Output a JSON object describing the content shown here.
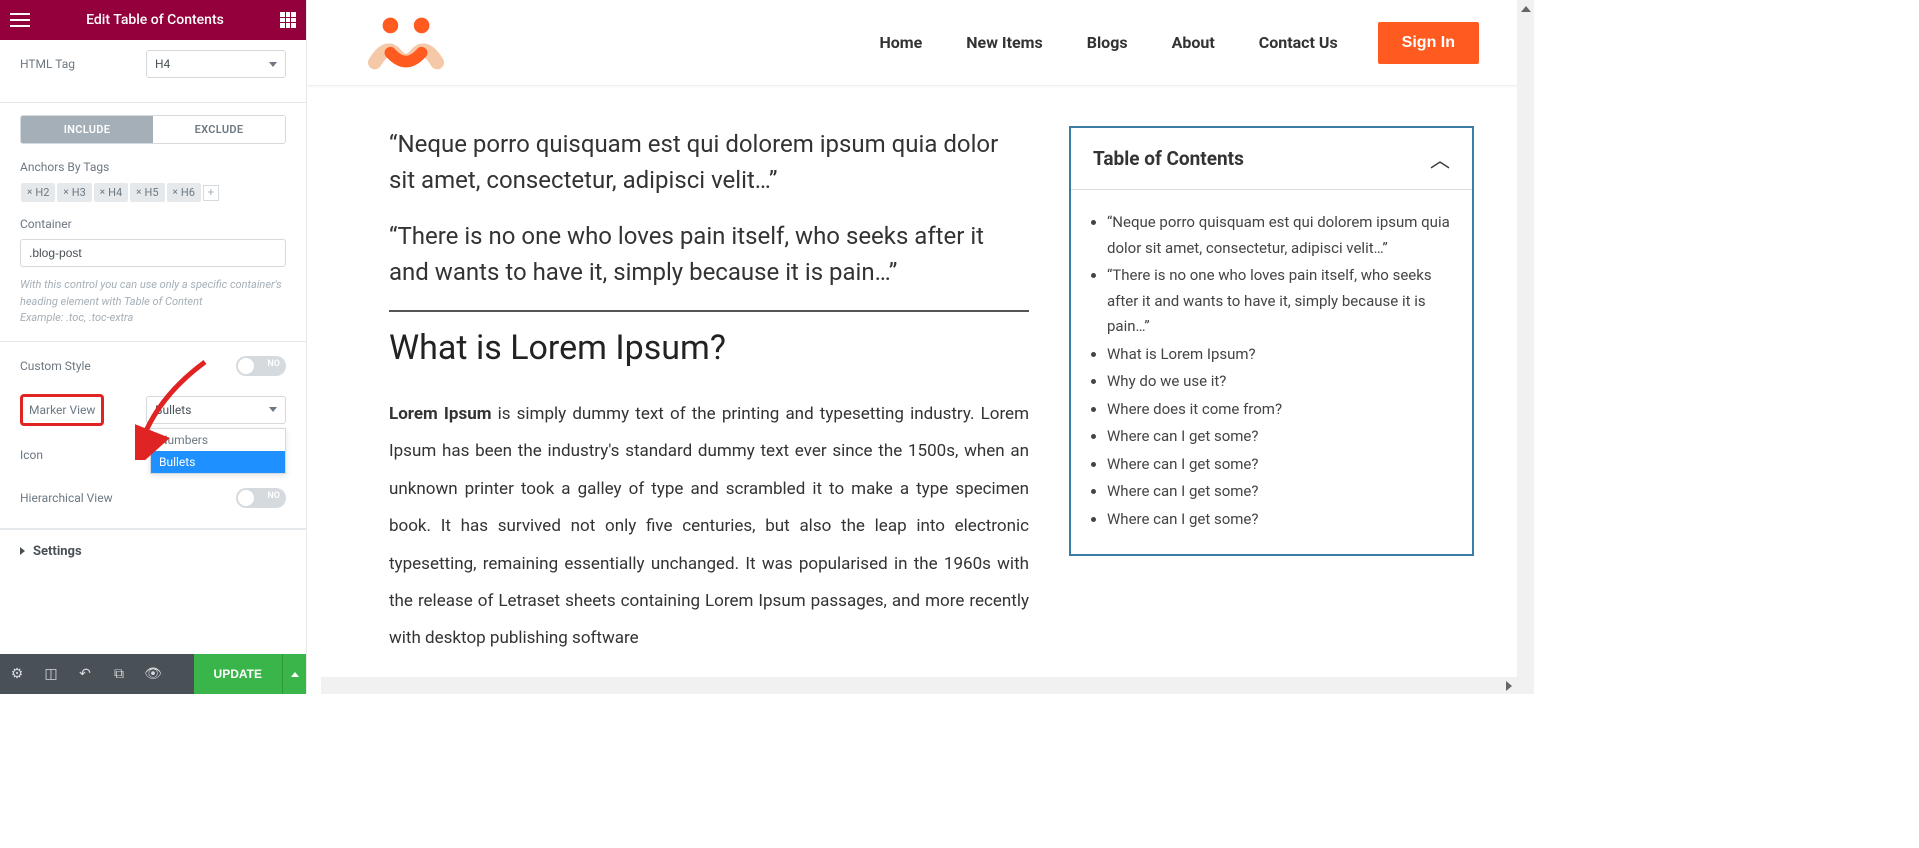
{
  "sidebar": {
    "title": "Edit Table of Contents",
    "html_tag_label": "HTML Tag",
    "html_tag_value": "H4",
    "include": "INCLUDE",
    "exclude": "EXCLUDE",
    "anchors_label": "Anchors By Tags",
    "tags": [
      "H2",
      "H3",
      "H4",
      "H5",
      "H6"
    ],
    "container_label": "Container",
    "container_value": ".blog-post",
    "helper1": "With this control you can use only a specific container's heading element with Table of Content",
    "helper2": "Example: .toc, .toc-extra",
    "custom_style_label": "Custom Style",
    "switch_no": "NO",
    "marker_view_label": "Marker View",
    "marker_view_value": "Bullets",
    "marker_options": {
      "opt1": "Numbers",
      "opt2": "Bullets"
    },
    "icon_label": "Icon",
    "hview_label": "Hierarchical View",
    "settings_label": "Settings",
    "update_label": "UPDATE"
  },
  "nav": {
    "home": "Home",
    "new_items": "New Items",
    "blogs": "Blogs",
    "about": "About",
    "contact": "Contact Us",
    "sign_in": "Sign In"
  },
  "article": {
    "q1": "“Neque porro quisquam est qui dolorem ipsum quia dolor sit amet, consectetur, adipisci velit…”",
    "q2": "“There is no one who loves pain itself, who seeks after it and wants to have it, simply because it is pain…”",
    "h2": "What is Lorem Ipsum?",
    "p_strong": "Lorem Ipsum",
    "p_rest": " is simply dummy text of the printing and typesetting industry. Lorem Ipsum has been the industry's standard dummy text ever since the 1500s, when an unknown printer took a galley of type and scrambled it to make a type specimen book. It has survived not only five centuries, but also the leap into electronic typesetting, remaining essentially unchanged. It was popularised in the 1960s with the release of Letraset sheets containing Lorem Ipsum passages, and more recently with desktop publishing software"
  },
  "toc": {
    "title": "Table of Contents",
    "items": {
      "i0": "“Neque porro quisquam est qui dolorem ipsum quia dolor sit amet, consectetur, adipisci velit…”",
      "i1": "“There is no one who loves pain itself, who seeks after it and wants to have it, simply because it is pain…”",
      "i2": "What is Lorem Ipsum?",
      "i3": "Why do we use it?",
      "i4": "Where does it come from?",
      "i5": "Where can I get some?",
      "i6": "Where can I get some?",
      "i7": "Where can I get some?",
      "i8": "Where can I get some?"
    }
  }
}
